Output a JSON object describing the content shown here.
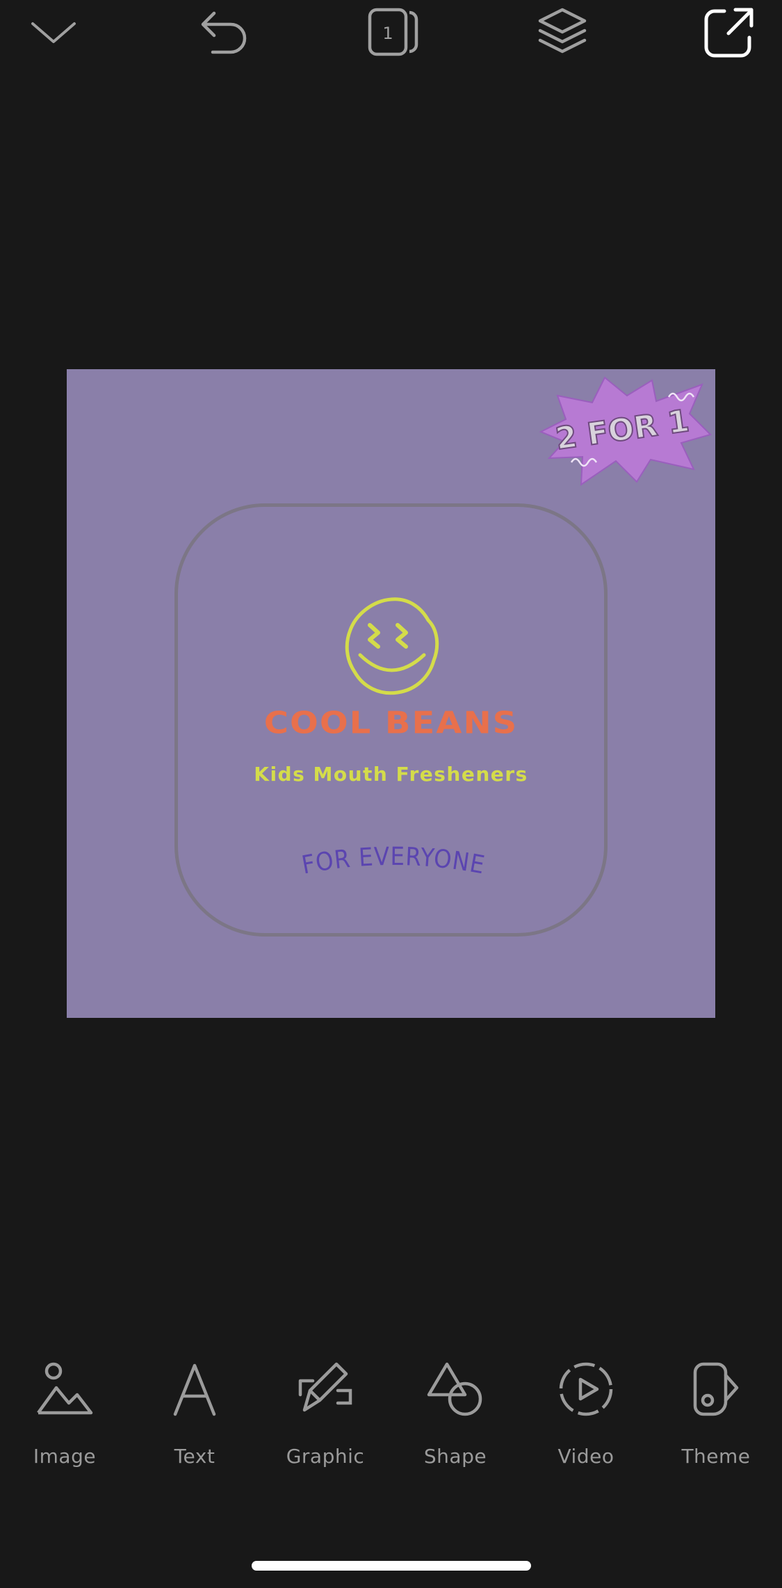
{
  "canvas": {
    "background": "#8a7fa9",
    "brand_name": "COOL BEANS",
    "tagline": "Kids Mouth Fresheners",
    "slogan": "FOR EVERYONE",
    "badge_text": "2 FOR 1",
    "colors": {
      "brand": "#e8704c",
      "tagline": "#d4dc4a",
      "slogan": "#5b45b0",
      "badge": "#b77ad3",
      "frame": "#7c7686"
    }
  },
  "topbar": {
    "page_count": "1",
    "icons": [
      "chevron-down-icon",
      "undo-icon",
      "pages-icon",
      "layers-icon",
      "share-icon"
    ]
  },
  "toolbar": {
    "items": [
      {
        "label": "Image",
        "icon": "image-icon"
      },
      {
        "label": "Text",
        "icon": "text-icon"
      },
      {
        "label": "Graphic",
        "icon": "graphic-icon"
      },
      {
        "label": "Shape",
        "icon": "shape-icon"
      },
      {
        "label": "Video",
        "icon": "video-icon"
      },
      {
        "label": "Theme",
        "icon": "theme-icon"
      }
    ]
  }
}
